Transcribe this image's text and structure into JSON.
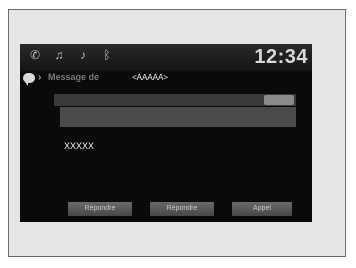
{
  "status_bar": {
    "clock": "12:34",
    "icons": [
      "phone-icon",
      "media-icon",
      "audio-icon",
      "bluetooth-icon"
    ]
  },
  "header": {
    "icon": "message-icon",
    "title": "Message de",
    "sender": "<AAAAA>"
  },
  "message": {
    "body": "XXXXX"
  },
  "buttons": [
    {
      "label": "Répondre"
    },
    {
      "label": "Répondre"
    },
    {
      "label": "Appel"
    }
  ]
}
